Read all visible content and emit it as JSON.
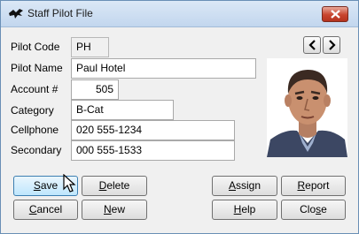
{
  "window": {
    "title": "Staff Pilot File"
  },
  "fields": {
    "pilot_code": {
      "label": "Pilot Code",
      "value": "PH"
    },
    "pilot_name": {
      "label": "Pilot Name",
      "value": "Paul Hotel"
    },
    "account": {
      "label": "Account #",
      "value": "505"
    },
    "category": {
      "label": "Category",
      "value": "B-Cat"
    },
    "cellphone": {
      "label": "Cellphone",
      "value": "020 555-1234"
    },
    "secondary": {
      "label": "Secondary",
      "value": "000 555-1533"
    }
  },
  "nav": {
    "prev_label": "<",
    "next_label": ">"
  },
  "buttons": {
    "save": {
      "mnemonic": "S",
      "rest": "ave"
    },
    "delete": {
      "mnemonic": "D",
      "rest": "elete"
    },
    "cancel": {
      "mnemonic": "C",
      "rest": "ancel"
    },
    "new": {
      "mnemonic": "N",
      "rest": "ew"
    },
    "assign": {
      "mnemonic": "A",
      "rest": "ssign"
    },
    "report": {
      "mnemonic": "R",
      "rest": "eport"
    },
    "help": {
      "mnemonic": "H",
      "rest": "elp"
    },
    "close": {
      "prefix": "Clo",
      "mnemonic": "s",
      "rest": "e"
    }
  },
  "colors": {
    "titlebar": "#c2d6ee",
    "window_bg": "#f0f0f0",
    "close_button": "#c8452f",
    "focus_button": "#bee6fd"
  },
  "icons": [
    "bird-app-icon",
    "close-icon",
    "chevron-left-icon",
    "chevron-right-icon",
    "pilot-photo",
    "mouse-cursor-icon"
  ]
}
